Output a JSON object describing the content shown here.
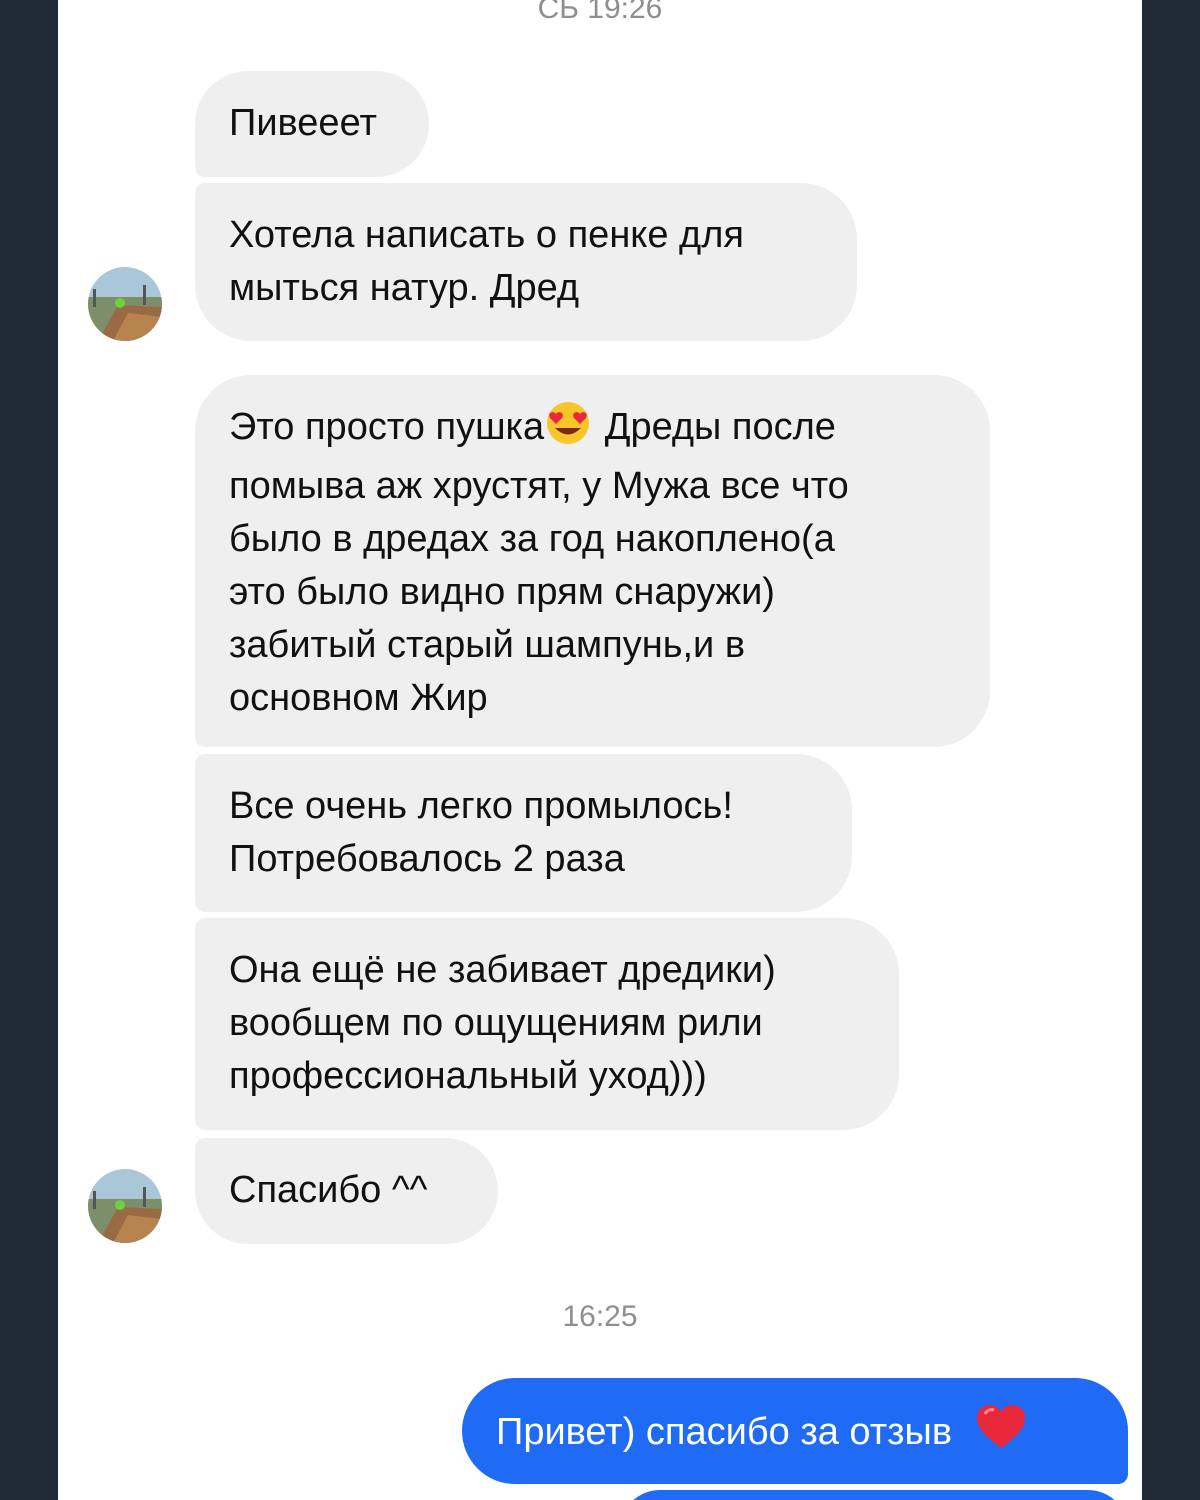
{
  "header": {
    "date_time": "СБ 19:26"
  },
  "messages": [
    {
      "text": "Пивееет"
    },
    {
      "line1": "Хотела написать о пенке для",
      "line2": "мыться натур. Дред"
    },
    {
      "line1_before": "Это просто пушка",
      "line1_emoji": "heart-eyes-emoji",
      "line1_after": " Дреды после",
      "line2": "помыва аж хрустят, у Мужа все что",
      "line3": "было в дредах за год накоплено(а",
      "line4": "это было видно прям снаружи)",
      "line5": "забитый старый шампунь,и в",
      "line6": "основном Жир"
    },
    {
      "line1": "Все очень легко промылось!",
      "line2": "Потребовалось 2 раза"
    },
    {
      "line1": "Она ещё не забивает дредики)",
      "line2": "вообщем по ощущениям рили",
      "line3": "профессиональный уход)))"
    },
    {
      "text": "Спасибо ^^"
    }
  ],
  "timestamp2": "16:25",
  "outgoing": {
    "text": "Привет) спасибо за отзыв",
    "emoji": "red-heart-emoji"
  },
  "colors": {
    "incoming": "#efefef",
    "outgoing": "#1f6bf5",
    "background": "#1f2a36",
    "timestamp": "#8e8e93"
  }
}
